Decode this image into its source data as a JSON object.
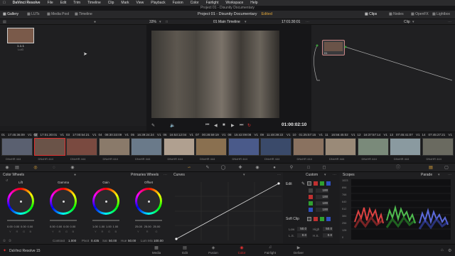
{
  "menubar": {
    "app": "DaVinci Resolve",
    "items": [
      "File",
      "Edit",
      "Trim",
      "Timeline",
      "Clip",
      "Mark",
      "View",
      "Playback",
      "Fusion",
      "Color",
      "Fairlight",
      "Workspace",
      "Help"
    ]
  },
  "window_title": "Project 01 - Disunity Documentary",
  "toolbar": {
    "gallery": "Gallery",
    "luts": "LUTs",
    "media_pool": "Media Pool",
    "timeline": "Timeline",
    "project": "Project 01 - Disunity Documentary",
    "edited": "Edited",
    "clips": "Clips",
    "nodes": "Nodes",
    "openfx": "OpenFX",
    "lightbox": "Lightbox"
  },
  "gallery": {
    "still_label": "1.1.1",
    "still_sub": "Lut3"
  },
  "viewer": {
    "zoom": "33%",
    "timeline_name": "01 Main Timeline",
    "source_tc": "17:01:30:01",
    "clip_menu": "Clip",
    "timecode": "01:00:02:10"
  },
  "nodes": {
    "node_label": "01"
  },
  "clips": [
    {
      "num": "01",
      "tc": "17:45:36:09",
      "track": "V1",
      "codec": "DNxHR 444",
      "color": "#5a6070"
    },
    {
      "num": "02",
      "tc": "17:01:30:01",
      "track": "V1",
      "codec": "DNxHR 444",
      "color": "#6a5348",
      "sel": true
    },
    {
      "num": "03",
      "tc": "17:00:54:21",
      "track": "V1",
      "codec": "DNxHR 444",
      "color": "#7a4a40"
    },
    {
      "num": "04",
      "tc": "08:30:33:09",
      "track": "V1",
      "codec": "DNxHR 444",
      "color": "#8a7a6a"
    },
    {
      "num": "05",
      "tc": "16:39:24:24",
      "track": "V1",
      "codec": "DNxHR 444",
      "color": "#6a7a8a"
    },
    {
      "num": "06",
      "tc": "16:53:12:04",
      "track": "V1",
      "codec": "DNxHR 444",
      "color": "#b0a090"
    },
    {
      "num": "07",
      "tc": "00:28:59:19",
      "track": "V1",
      "codec": "DNxHR 444",
      "color": "#8a7050"
    },
    {
      "num": "08",
      "tc": "15:42:09:08",
      "track": "V1",
      "codec": "DNxHR 444",
      "color": "#4a5a8a"
    },
    {
      "num": "09",
      "tc": "11:48:39:22",
      "track": "V1",
      "codec": "DNxHR 444",
      "color": "#3a4a6a"
    },
    {
      "num": "10",
      "tc": "01:25:57:15",
      "track": "V1",
      "codec": "DNxHR 444",
      "color": "#8a7260"
    },
    {
      "num": "11",
      "tc": "16:56:45:02",
      "track": "V1",
      "codec": "DNxHR 444",
      "color": "#9a8a78"
    },
    {
      "num": "12",
      "tc": "16:37:57:14",
      "track": "V1",
      "codec": "DNxHR 444",
      "color": "#7a8a7a"
    },
    {
      "num": "13",
      "tc": "07:45:41:07",
      "track": "V1",
      "codec": "DNxHR 444",
      "color": "#8a9aa0"
    },
    {
      "num": "14",
      "tc": "07:45:27:21",
      "track": "V1",
      "codec": "DNxHR 444",
      "color": "#6a6a60"
    }
  ],
  "color_wheels": {
    "title": "Color Wheels",
    "mode": "Primaries Wheels",
    "wheels": [
      {
        "label": "Lift",
        "values": [
          "0.00",
          "0.00",
          "0.00",
          "0.00"
        ]
      },
      {
        "label": "Gamma",
        "values": [
          "0.00",
          "0.00",
          "0.00",
          "0.00"
        ]
      },
      {
        "label": "Gain",
        "values": [
          "1.00",
          "1.00",
          "1.00",
          "1.00"
        ]
      },
      {
        "label": "Offset",
        "values": [
          "25.00",
          "25.00",
          "25.00"
        ]
      }
    ],
    "channels": [
      "Y",
      "R",
      "G",
      "B"
    ],
    "contrast_label": "Contrast",
    "contrast": "1.000",
    "pivot_label": "Pivot",
    "pivot": "0.435",
    "sat_label": "Sat",
    "sat": "50.00",
    "hue_label": "Hue",
    "hue": "50.00",
    "lummix_label": "Lum Mix",
    "lummix": "100.00"
  },
  "curves": {
    "title": "Curves",
    "mode": "Custom"
  },
  "edit": {
    "title": "Edit",
    "values": [
      "100",
      "100",
      "100",
      "100"
    ],
    "softclip_title": "Soft Clip",
    "low_label": "Low",
    "low": "50.0",
    "high_label": "High",
    "high": "50.0",
    "ls_label": "L.S.",
    "ls": "0.0",
    "hs_label": "H.S.",
    "hs": "0.0"
  },
  "scopes": {
    "title": "Scopes",
    "mode": "Parade",
    "ticks": [
      "1023",
      "896",
      "768",
      "640",
      "512",
      "384",
      "256",
      "128",
      "0"
    ]
  },
  "pages": [
    "Media",
    "Edit",
    "Fusion",
    "Color",
    "Fairlight",
    "Deliver"
  ],
  "active_page": "Color",
  "bottom": {
    "app_version": "DaVinci Resolve 15"
  },
  "colors": {
    "accent": "#e0a63a",
    "active": "#e03030",
    "bg": "#1c1c1e"
  }
}
